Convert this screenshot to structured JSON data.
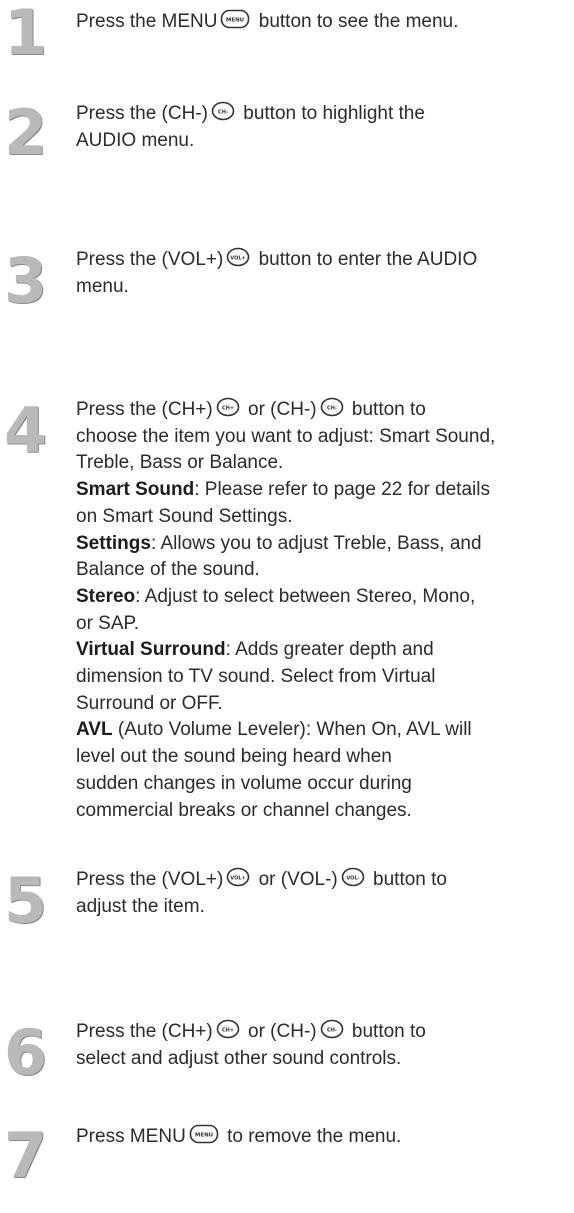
{
  "steps": [
    {
      "number": "1",
      "lines": [
        [
          "Press the MENU",
          {
            "icon": "menu-button-icon",
            "label": "MENU"
          },
          "button to see the menu."
        ]
      ]
    },
    {
      "number": "2",
      "lines": [
        [
          "Press the (CH-)",
          {
            "icon": "ch-minus-button-icon",
            "label": "CH-"
          },
          "button to highlight the"
        ],
        [
          "AUDIO menu."
        ]
      ]
    },
    {
      "number": "3",
      "lines": [
        [
          "Press the (VOL+)",
          {
            "icon": "vol-plus-button-icon",
            "label": "VOL+"
          },
          "button to enter the AUDIO"
        ],
        [
          "menu."
        ]
      ]
    },
    {
      "number": "4",
      "lines": [
        [
          "Press the (CH+)",
          {
            "icon": "ch-plus-button-icon",
            "label": "CH+"
          },
          "or (CH-)",
          {
            "icon": "ch-minus-button-icon",
            "label": "CH-"
          },
          "button to"
        ],
        [
          "choose the item you want to adjust: Smart Sound,"
        ],
        [
          "Treble, Bass or Balance."
        ],
        [
          {
            "bold": "Smart Sound"
          },
          ": Please refer to page 22 for details"
        ],
        [
          "on Smart Sound Settings."
        ],
        [
          {
            "bold": "Settings"
          },
          ": Allows you to adjust Treble, Bass, and"
        ],
        [
          "Balance of the sound."
        ],
        [
          {
            "bold": "Stereo"
          },
          ": Adjust to select between Stereo, Mono,"
        ],
        [
          "or SAP."
        ],
        [
          {
            "bold": "Virtual Surround"
          },
          ": Adds greater depth and"
        ],
        [
          "dimension to TV sound. Select from Virtual"
        ],
        [
          "Surround or OFF."
        ],
        [
          {
            "bold": "AVL"
          },
          " (Auto Volume Leveler): When On, AVL will"
        ],
        [
          "level out the sound being heard when"
        ],
        [
          "sudden changes in volume occur during"
        ],
        [
          "commercial breaks or channel changes."
        ]
      ]
    },
    {
      "number": "5",
      "lines": [
        [
          "Press the (VOL+)",
          {
            "icon": "vol-plus-button-icon",
            "label": "VOL+"
          },
          "or (VOL-)",
          {
            "icon": "vol-minus-button-icon",
            "label": "VOL-"
          },
          "button to"
        ],
        [
          "adjust the item."
        ]
      ]
    },
    {
      "number": "6",
      "lines": [
        [
          "Press the (CH+)",
          {
            "icon": "ch-plus-button-icon",
            "label": "CH+"
          },
          "or (CH-)",
          {
            "icon": "ch-minus-button-icon",
            "label": "CH-"
          },
          "button to"
        ],
        [
          "select and adjust other sound controls."
        ]
      ]
    },
    {
      "number": "7",
      "lines": [
        [
          "Press MENU",
          {
            "icon": "menu-button-icon",
            "label": "MENU"
          },
          "to remove the menu."
        ]
      ]
    }
  ]
}
